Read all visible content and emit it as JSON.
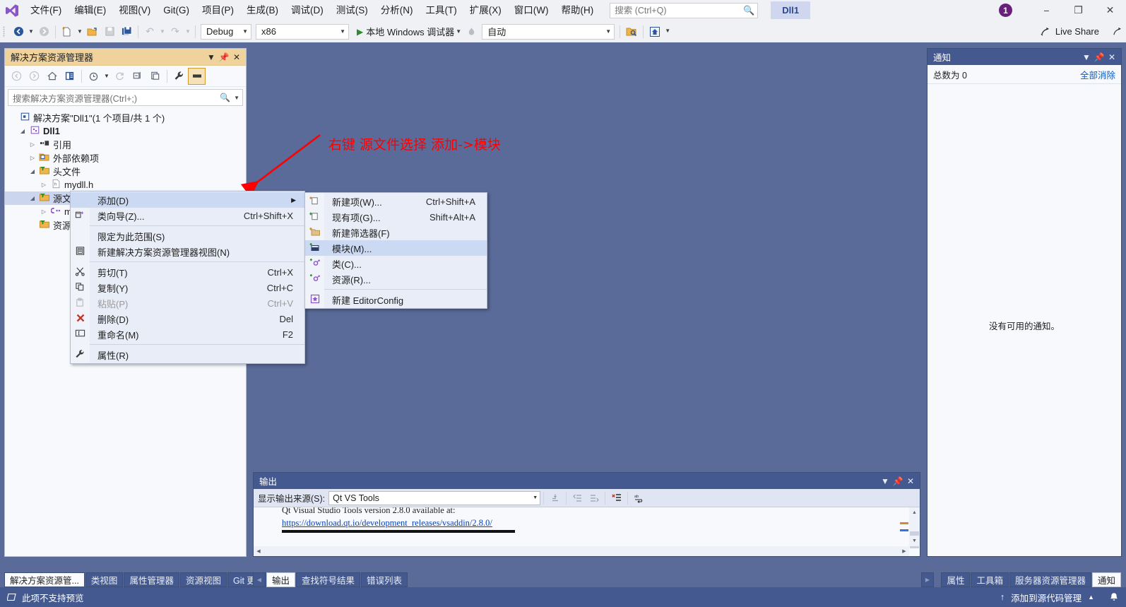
{
  "menubar": {
    "logo": "visual-studio-logo",
    "items": [
      {
        "label": "文件(F)"
      },
      {
        "label": "编辑(E)"
      },
      {
        "label": "视图(V)"
      },
      {
        "label": "Git(G)"
      },
      {
        "label": "项目(P)"
      },
      {
        "label": "生成(B)"
      },
      {
        "label": "调试(D)"
      },
      {
        "label": "测试(S)"
      },
      {
        "label": "分析(N)"
      },
      {
        "label": "工具(T)"
      },
      {
        "label": "扩展(X)"
      },
      {
        "label": "窗口(W)"
      },
      {
        "label": "帮助(H)"
      }
    ],
    "search_placeholder": "搜索 (Ctrl+Q)",
    "doc_tab": "Dll1",
    "notification_count": "1",
    "minimize": "−",
    "restore": "❐",
    "close": "✕"
  },
  "toolbar": {
    "back": "navigate-back",
    "forward": "navigate-forward",
    "new_project": "new-project",
    "open": "open-file",
    "save": "save",
    "save_all": "save-all",
    "undo": "undo",
    "redo": "redo",
    "configuration": "Debug",
    "platform": "x86",
    "run_label": "本地 Windows 调试器",
    "attach": "自动",
    "live_share": "Live Share"
  },
  "solution_explorer": {
    "title": "解决方案资源管理器",
    "search_placeholder": "搜索解决方案资源管理器(Ctrl+;)",
    "tree": [
      {
        "indent": 0,
        "twisty": "",
        "icon": "solution-icon",
        "label": "解决方案\"Dll1\"(1 个项目/共 1 个)",
        "bold": false,
        "selected": false
      },
      {
        "indent": 1,
        "twisty": "▲",
        "icon": "project-icon",
        "label": "Dll1",
        "bold": true,
        "selected": false
      },
      {
        "indent": 2,
        "twisty": "▷",
        "icon": "references-icon",
        "label": "引用",
        "bold": false,
        "selected": false
      },
      {
        "indent": 2,
        "twisty": "▷",
        "icon": "external-deps-icon",
        "label": "外部依赖项",
        "bold": false,
        "selected": false
      },
      {
        "indent": 2,
        "twisty": "▲",
        "icon": "filter-folder-icon",
        "label": "头文件",
        "bold": false,
        "selected": false
      },
      {
        "indent": 3,
        "twisty": "▷",
        "icon": "header-file-icon",
        "label": "mydll.h",
        "bold": false,
        "selected": false
      },
      {
        "indent": 2,
        "twisty": "▲",
        "icon": "filter-folder-icon",
        "label": "源文件",
        "bold": false,
        "selected": true
      },
      {
        "indent": 3,
        "twisty": "▷",
        "icon": "cpp-file-icon",
        "label": "m",
        "bold": false,
        "selected": false
      },
      {
        "indent": 2,
        "twisty": "",
        "icon": "filter-folder-icon",
        "label": "资源",
        "bold": false,
        "selected": false
      }
    ]
  },
  "annotation": {
    "text": "右键 源文件选择 添加->模块",
    "color": "#fe0000",
    "arrow": "red-arrow-pointing-to-source-files"
  },
  "context_menu": {
    "items": [
      {
        "label": "添加(D)",
        "shortcut": "",
        "icon": "",
        "submenu": true,
        "highlighted": true,
        "disabled": false
      },
      {
        "label": "类向导(Z)...",
        "shortcut": "Ctrl+Shift+X",
        "icon": "class-wizard-icon",
        "submenu": false,
        "highlighted": false,
        "disabled": false
      },
      {
        "separator": true
      },
      {
        "label": "限定为此范围(S)",
        "shortcut": "",
        "icon": "",
        "submenu": false,
        "highlighted": false,
        "disabled": false
      },
      {
        "label": "新建解决方案资源管理器视图(N)",
        "shortcut": "",
        "icon": "new-view-icon",
        "submenu": false,
        "highlighted": false,
        "disabled": false
      },
      {
        "separator": true
      },
      {
        "label": "剪切(T)",
        "shortcut": "Ctrl+X",
        "icon": "scissors-icon",
        "submenu": false,
        "highlighted": false,
        "disabled": false
      },
      {
        "label": "复制(Y)",
        "shortcut": "Ctrl+C",
        "icon": "copy-icon",
        "submenu": false,
        "highlighted": false,
        "disabled": false
      },
      {
        "label": "粘贴(P)",
        "shortcut": "Ctrl+V",
        "icon": "paste-icon",
        "submenu": false,
        "highlighted": false,
        "disabled": true
      },
      {
        "label": "删除(D)",
        "shortcut": "Del",
        "icon": "delete-x-icon",
        "submenu": false,
        "highlighted": false,
        "disabled": false
      },
      {
        "label": "重命名(M)",
        "shortcut": "F2",
        "icon": "rename-icon",
        "submenu": false,
        "highlighted": false,
        "disabled": false
      },
      {
        "separator": true
      },
      {
        "label": "属性(R)",
        "shortcut": "",
        "icon": "wrench-icon",
        "submenu": false,
        "highlighted": false,
        "disabled": false
      }
    ]
  },
  "submenu": {
    "items": [
      {
        "label": "新建项(W)...",
        "shortcut": "Ctrl+Shift+A",
        "icon": "new-item-icon",
        "highlighted": false
      },
      {
        "label": "现有项(G)...",
        "shortcut": "Shift+Alt+A",
        "icon": "existing-item-icon",
        "highlighted": false
      },
      {
        "label": "新建筛选器(F)",
        "shortcut": "",
        "icon": "new-filter-icon",
        "highlighted": false
      },
      {
        "label": "模块(M)...",
        "shortcut": "",
        "icon": "module-icon",
        "highlighted": true
      },
      {
        "label": "类(C)...",
        "shortcut": "",
        "icon": "class-icon",
        "highlighted": false
      },
      {
        "label": "资源(R)...",
        "shortcut": "",
        "icon": "resource-icon",
        "highlighted": false
      },
      {
        "separator": true
      },
      {
        "label": "新建 EditorConfig",
        "shortcut": "",
        "icon": "editorconfig-icon",
        "highlighted": false
      }
    ]
  },
  "output_panel": {
    "title": "输出",
    "source_label": "显示输出来源(S):",
    "source_value": "Qt VS Tools",
    "lines": [
      {
        "text": "Qt Visual Studio Tools version 2.8.0 available at:",
        "link": false
      },
      {
        "text": "https://download.qt.io/development_releases/vsaddin/2.8.0/",
        "link": true
      }
    ],
    "toolbar_icons": [
      "find-message-icon",
      "previous-message-icon",
      "next-message-icon",
      "clear-all-icon",
      "toggle-word-wrap-icon"
    ]
  },
  "notification_panel": {
    "title": "通知",
    "count_label": "总数为 0",
    "clear_all": "全部消除",
    "empty_text": "没有可用的通知。"
  },
  "bottom_tabs_left": [
    {
      "label": "解决方案资源管...",
      "active": true
    },
    {
      "label": "类视图",
      "active": false
    },
    {
      "label": "属性管理器",
      "active": false
    },
    {
      "label": "资源视图",
      "active": false
    },
    {
      "label": "Git 更改",
      "active": false
    },
    {
      "label": "输出",
      "active": true
    },
    {
      "label": "查找符号结果",
      "active": false
    },
    {
      "label": "错误列表",
      "active": false
    }
  ],
  "bottom_tabs_right": [
    {
      "label": "属性",
      "active": false
    },
    {
      "label": "工具箱",
      "active": false
    },
    {
      "label": "服务器资源管理器",
      "active": false
    },
    {
      "label": "通知",
      "active": true
    }
  ],
  "statusbar": {
    "left_text": "此项不支持预览",
    "left_icon": "preview-icon",
    "right_text": "添加到源代码管理",
    "up_arrow": "↑",
    "caret": "▲",
    "bell": "bell-icon"
  },
  "colors": {
    "main_bg": "#5a6a99",
    "panel_header": "#44598f",
    "se_header": "#f0d39c",
    "accent_link": "#0a5bc4",
    "annotation_red": "#fe0000",
    "badge_purple": "#68217a"
  }
}
